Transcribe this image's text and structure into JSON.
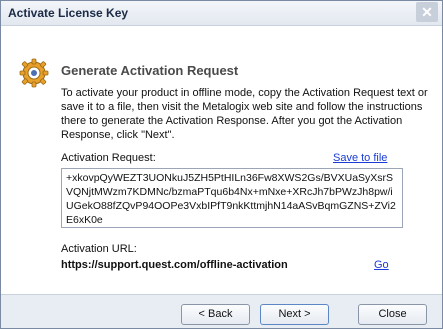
{
  "window": {
    "title": "Activate License Key",
    "close_glyph": "✕"
  },
  "header": {
    "title": "Generate Activation Request",
    "icon": "gear-icon"
  },
  "description": "To activate your product in offline mode, copy the Activation Request text or save it to a file, then visit the Metalogix web site and follow the instructions there to generate the Activation Response. After you got the Activation Response, click \"Next\".",
  "request": {
    "label": "Activation Request:",
    "save_link": "Save to file",
    "value": "+xkovpQyWEZT3UONkuJ5ZH5PtHILn36Fw8XWS2Gs/BVXUaSyXsrSVQNjtMWzm7KDMNc/bzmaPTqu6b4Nx+mNxe+XRcJh7bPWzJh8pw/iUGekO88fZQvP94OOPe3VxbIPfT9nkKttmjhN14aASvBqmGZNS+ZVi2E6xK0e"
  },
  "url": {
    "label": "Activation URL:",
    "value": "https://support.quest.com/offline-activation",
    "go_link": "Go"
  },
  "buttons": {
    "back": "< Back",
    "next": "Next >",
    "close": "Close"
  },
  "colors": {
    "link": "#1a3bd6",
    "footer_bg": "#e8edf4",
    "gear_orange": "#e8a02a"
  }
}
